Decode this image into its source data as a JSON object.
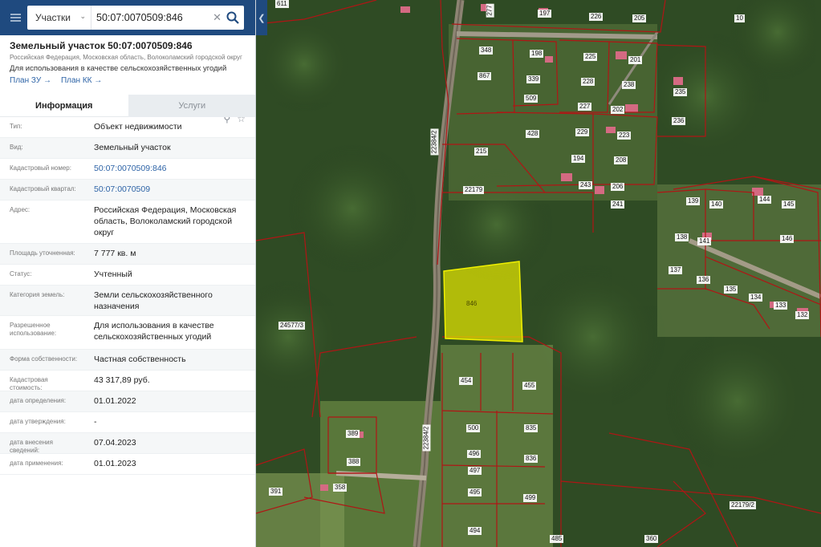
{
  "search": {
    "type_label": "Участки",
    "query": "50:07:0070509:846"
  },
  "card": {
    "title": "Земельный участок 50:07:0070509:846",
    "address": "Российская Федерация, Московская область, Волоколамский городской округ",
    "use": "Для использования в качестве сельскохозяйственных угодий",
    "links": [
      "План ЗУ",
      "План КК"
    ]
  },
  "tabs": [
    "Информация",
    "Услуги"
  ],
  "properties": [
    {
      "key": "Тип:",
      "value": "Объект недвижимости"
    },
    {
      "key": "Вид:",
      "value": "Земельный участок"
    },
    {
      "key": "Кадастровый номер:",
      "value": "50:07:0070509:846"
    },
    {
      "key": "Кадастровый квартал:",
      "value": "50:07:0070509"
    },
    {
      "key": "Адрес:",
      "value": "Российская Федерация, Московская область, Волоколамский городской округ"
    },
    {
      "key": "Площадь уточненная:",
      "value": "7 777 кв. м"
    },
    {
      "key": "Статус:",
      "value": "Учтенный"
    },
    {
      "key": "Категория земель:",
      "value": "Земли сельскохозяйственного назначения"
    },
    {
      "key": "Разрешенное использование:",
      "value": "Для использования в качестве сельскохозяйственных угодий"
    },
    {
      "key": "Форма собственности:",
      "value": "Частная собственность"
    },
    {
      "key": "Кадастровая стоимость:",
      "value": "43 317,89 руб."
    },
    {
      "key": "дата определения:",
      "value": "01.01.2022"
    },
    {
      "key": "дата утверждения:",
      "value": "-"
    },
    {
      "key": "дата внесения сведений:",
      "value": "07.04.2023"
    },
    {
      "key": "дата применения:",
      "value": "01.01.2023"
    }
  ],
  "map": {
    "highlight_label": "846",
    "plot_numbers": [
      "611",
      "277",
      "197",
      "226",
      "205",
      "10",
      "348",
      "198",
      "225",
      "201",
      "867",
      "339",
      "228",
      "238",
      "235",
      "509",
      "227",
      "202",
      "236",
      "428",
      "229",
      "223",
      "215",
      "194",
      "208",
      "22179",
      "243",
      "206",
      "241",
      "139",
      "140",
      "144",
      "145",
      "138",
      "141",
      "146",
      "137",
      "136",
      "135",
      "134",
      "133",
      "132",
      "24577/3",
      "454",
      "455",
      "500",
      "835",
      "496",
      "836",
      "497",
      "495",
      "499",
      "494",
      "485",
      "389",
      "388",
      "391",
      "358",
      "360",
      "22179/2"
    ],
    "road_labels": [
      "22384/2",
      "22384/2"
    ],
    "colors": {
      "boundary": "#b01515",
      "highlight_fill": "#e3e600",
      "panel_header": "#1f4a7f",
      "link": "#2d63a6"
    }
  }
}
